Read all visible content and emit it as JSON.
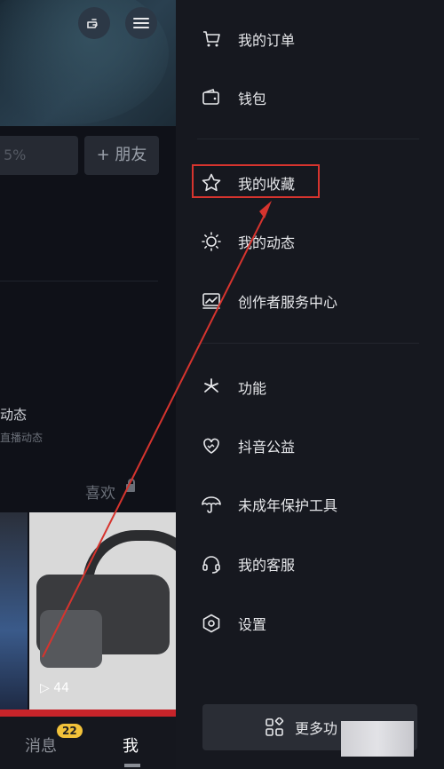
{
  "left": {
    "stat_text": "5%",
    "add_friend": "+ 朋友",
    "dynamic_title": "动态",
    "dynamic_sub": "直播动态",
    "likes_label": "喜欢",
    "thumb_views": "▷ 44",
    "nav": {
      "messages": "消息",
      "messages_badge": "22",
      "me": "我"
    }
  },
  "menu": {
    "items": [
      {
        "label": "我的订单",
        "icon": "cart-icon"
      },
      {
        "label": "钱包",
        "icon": "wallet-icon"
      },
      {
        "label": "我的收藏",
        "icon": "star-icon"
      },
      {
        "label": "我的动态",
        "icon": "sun-icon"
      },
      {
        "label": "创作者服务中心",
        "icon": "chart-icon"
      },
      {
        "label": "功能",
        "icon": "sparkle-icon"
      },
      {
        "label": "抖音公益",
        "icon": "heart-hands-icon"
      },
      {
        "label": "未成年保护工具",
        "icon": "umbrella-icon"
      },
      {
        "label": "我的客服",
        "icon": "headset-icon"
      },
      {
        "label": "设置",
        "icon": "settings-hex-icon"
      }
    ],
    "more_label": "更多功"
  },
  "colors": {
    "highlight": "#d6342e",
    "badge": "#f2c23a",
    "panel_bg": "#16181f"
  }
}
